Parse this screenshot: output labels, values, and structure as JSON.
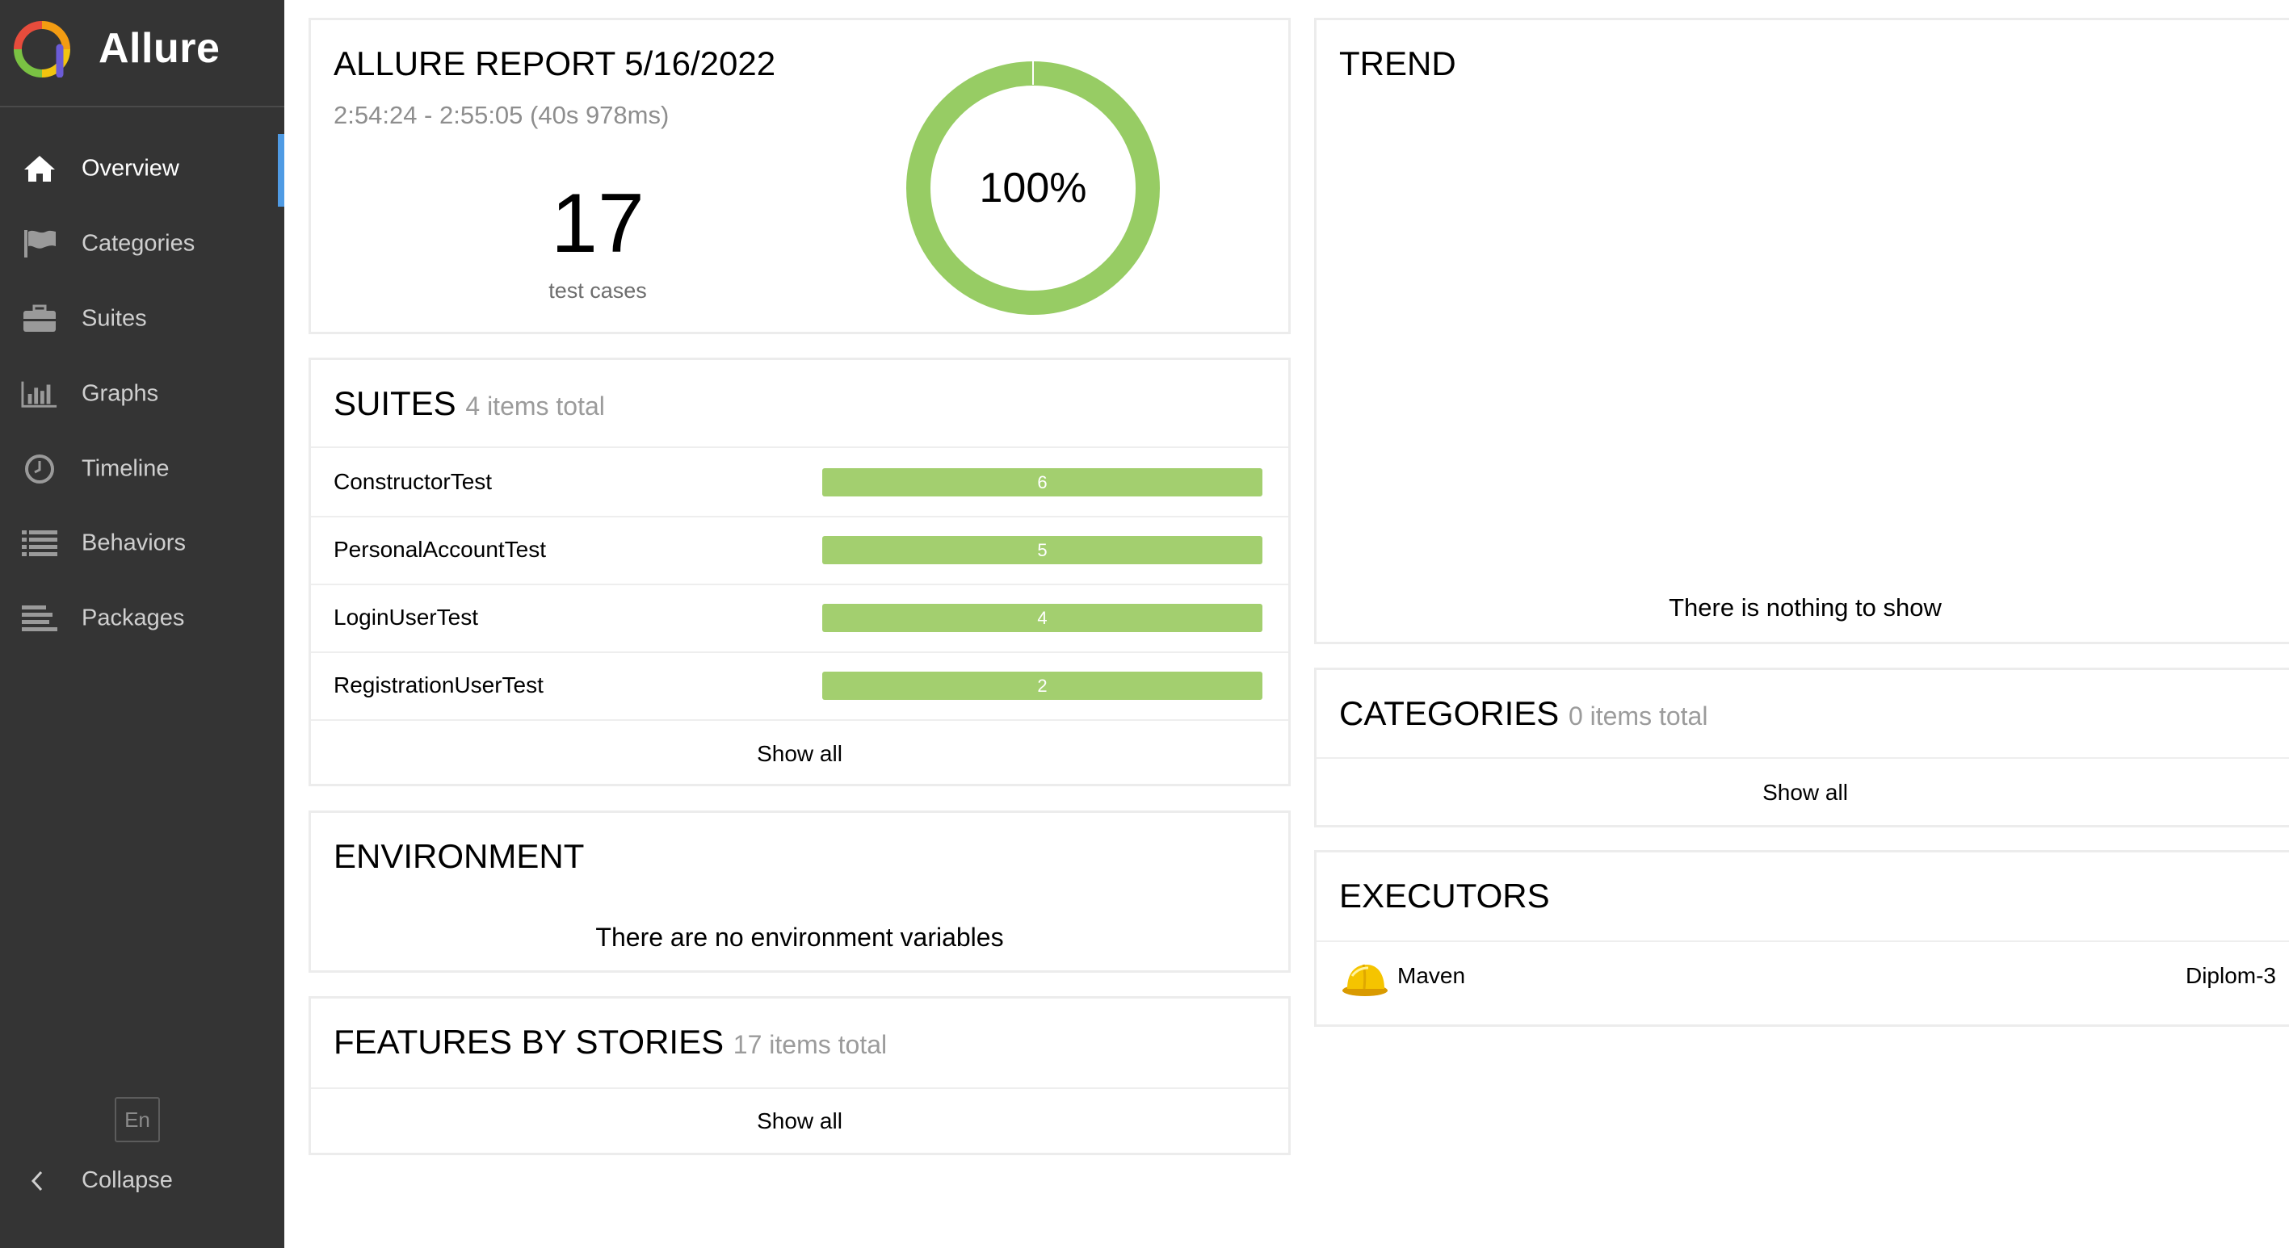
{
  "brand": {
    "name": "Allure"
  },
  "sidebar": {
    "items": [
      {
        "label": "Overview",
        "icon": "home-icon",
        "active": true
      },
      {
        "label": "Categories",
        "icon": "flag-icon"
      },
      {
        "label": "Suites",
        "icon": "briefcase-icon"
      },
      {
        "label": "Graphs",
        "icon": "bar-chart-icon"
      },
      {
        "label": "Timeline",
        "icon": "clock-icon"
      },
      {
        "label": "Behaviors",
        "icon": "list-icon"
      },
      {
        "label": "Packages",
        "icon": "align-left-icon"
      }
    ],
    "language": "En",
    "collapse_label": "Collapse"
  },
  "summary": {
    "title": "ALLURE REPORT 5/16/2022",
    "duration": "2:54:24 - 2:55:05 (40s 978ms)",
    "count": "17",
    "count_label": "test cases",
    "percent": "100%",
    "pass_fraction": 1.0,
    "color": "#97cc64"
  },
  "suites": {
    "title": "SUITES",
    "total": "4 items total",
    "rows": [
      {
        "name": "ConstructorTest",
        "count": "6"
      },
      {
        "name": "PersonalAccountTest",
        "count": "5"
      },
      {
        "name": "LoginUserTest",
        "count": "4"
      },
      {
        "name": "RegistrationUserTest",
        "count": "2"
      }
    ],
    "bar_color": "#a3cf6f",
    "show_all": "Show all"
  },
  "environment": {
    "title": "ENVIRONMENT",
    "empty": "There are no environment variables"
  },
  "features": {
    "title": "FEATURES BY STORIES",
    "total": "17 items total",
    "show_all": "Show all"
  },
  "trend": {
    "title": "TREND",
    "empty": "There is nothing to show"
  },
  "categories": {
    "title": "CATEGORIES",
    "total": "0 items total",
    "show_all": "Show all"
  },
  "executors": {
    "title": "EXECUTORS",
    "items": [
      {
        "name": "Maven",
        "build": "Diplom-3",
        "icon": "maven-hardhat-icon"
      }
    ]
  },
  "colors": {
    "sidebar": "#343434",
    "accent": "#4f9be4",
    "passed": "#97cc64"
  }
}
